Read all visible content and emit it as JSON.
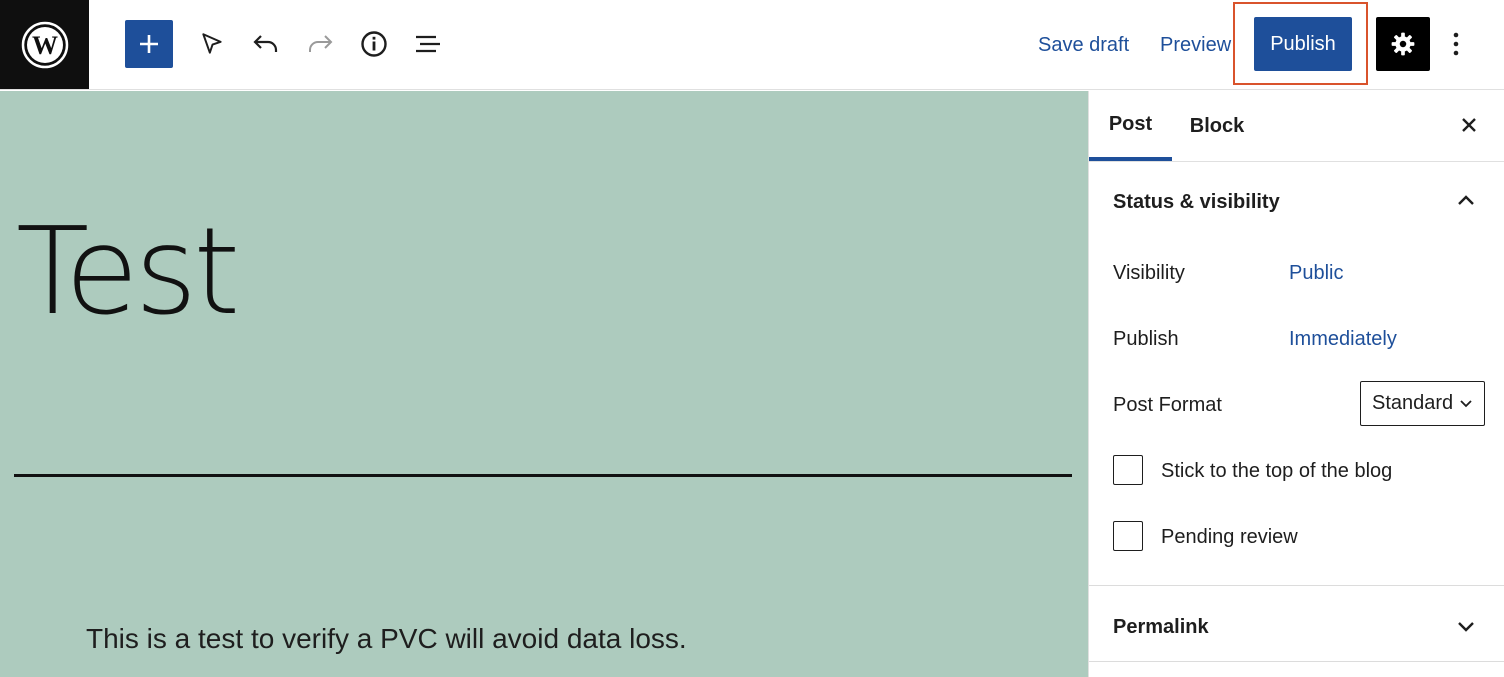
{
  "toolbar": {
    "save_draft": "Save draft",
    "preview": "Preview",
    "publish": "Publish"
  },
  "canvas": {
    "title": "Test",
    "paragraph": "This is a test to verify a PVC will avoid data loss.",
    "background_color": "#adcbbe"
  },
  "sidebar": {
    "tabs": [
      "Post",
      "Block"
    ],
    "active_tab": "Post",
    "status_panel": {
      "title": "Status & visibility",
      "visibility_label": "Visibility",
      "visibility_value": "Public",
      "publish_label": "Publish",
      "publish_value": "Immediately",
      "format_label": "Post Format",
      "format_value": "Standard",
      "stick_label": "Stick to the top of the blog",
      "pending_label": "Pending review"
    },
    "permalink_panel": {
      "title": "Permalink"
    }
  },
  "colors": {
    "accent": "#1e4f9a",
    "highlight": "#d9532c"
  }
}
